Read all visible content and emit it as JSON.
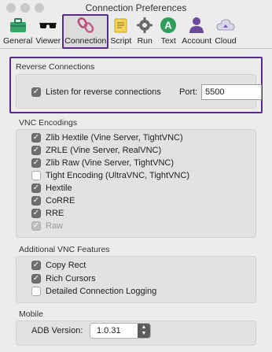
{
  "window": {
    "title": "Connection Preferences"
  },
  "toolbar": {
    "items": [
      {
        "label": "General",
        "icon": "toolbox-icon"
      },
      {
        "label": "Viewer",
        "icon": "glasses-icon"
      },
      {
        "label": "Connection",
        "icon": "chain-link-icon",
        "selected": true
      },
      {
        "label": "Script",
        "icon": "script-icon"
      },
      {
        "label": "Run",
        "icon": "gear-icon"
      },
      {
        "label": "Text",
        "icon": "text-a-icon"
      },
      {
        "label": "Account",
        "icon": "person-icon"
      },
      {
        "label": "Cloud",
        "icon": "cloud-icon"
      }
    ]
  },
  "reverse": {
    "title": "Reverse Connections",
    "listen_label": "Listen for reverse connections",
    "listen_checked": true,
    "port_label": "Port:",
    "port_value": "5500"
  },
  "encodings": {
    "title": "VNC Encodings",
    "items": [
      {
        "label": "Zlib Hextile (Vine Server, TightVNC)",
        "checked": true
      },
      {
        "label": "ZRLE (Vine Server, RealVNC)",
        "checked": true
      },
      {
        "label": "Zlib Raw (Vine Server, TightVNC)",
        "checked": true
      },
      {
        "label": "Tight Encoding (UltraVNC, TightVNC)",
        "checked": false
      },
      {
        "label": "Hextile",
        "checked": true
      },
      {
        "label": "CoRRE",
        "checked": true
      },
      {
        "label": "RRE",
        "checked": true
      },
      {
        "label": "Raw",
        "checked": true,
        "disabled": true
      }
    ]
  },
  "features": {
    "title": "Additional VNC Features",
    "items": [
      {
        "label": "Copy Rect",
        "checked": true
      },
      {
        "label": "Rich Cursors",
        "checked": true
      },
      {
        "label": "Detailed Connection Logging",
        "checked": false
      }
    ]
  },
  "mobile": {
    "title": "Mobile",
    "adb_label": "ADB Version:",
    "adb_value": "1.0.31"
  },
  "colors": {
    "highlight": "#5a2a8c",
    "checkbox_on": "#6f6f6f"
  }
}
